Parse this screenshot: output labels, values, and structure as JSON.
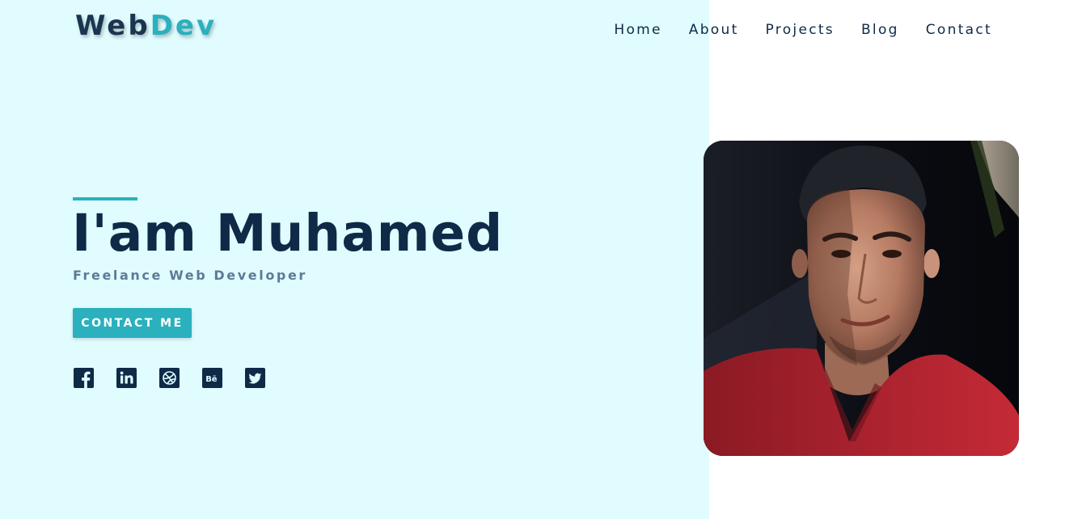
{
  "header": {
    "logo_part1": "Web",
    "logo_part2": "Dev",
    "nav": [
      "Home",
      "About",
      "Projects",
      "Blog",
      "Contact"
    ]
  },
  "hero": {
    "title": "I'am Muhamed",
    "subtitle": "Freelance Web Developer",
    "cta_label": "CONTACT ME"
  },
  "socials": [
    "facebook-icon",
    "linkedin-icon",
    "dribbble-icon",
    "behance-icon",
    "twitter-icon"
  ],
  "colors": {
    "accent": "#2bb0bd",
    "dark": "#0e2a47",
    "panel_bg": "#e0fcff",
    "subtitle": "#5e7a97"
  }
}
